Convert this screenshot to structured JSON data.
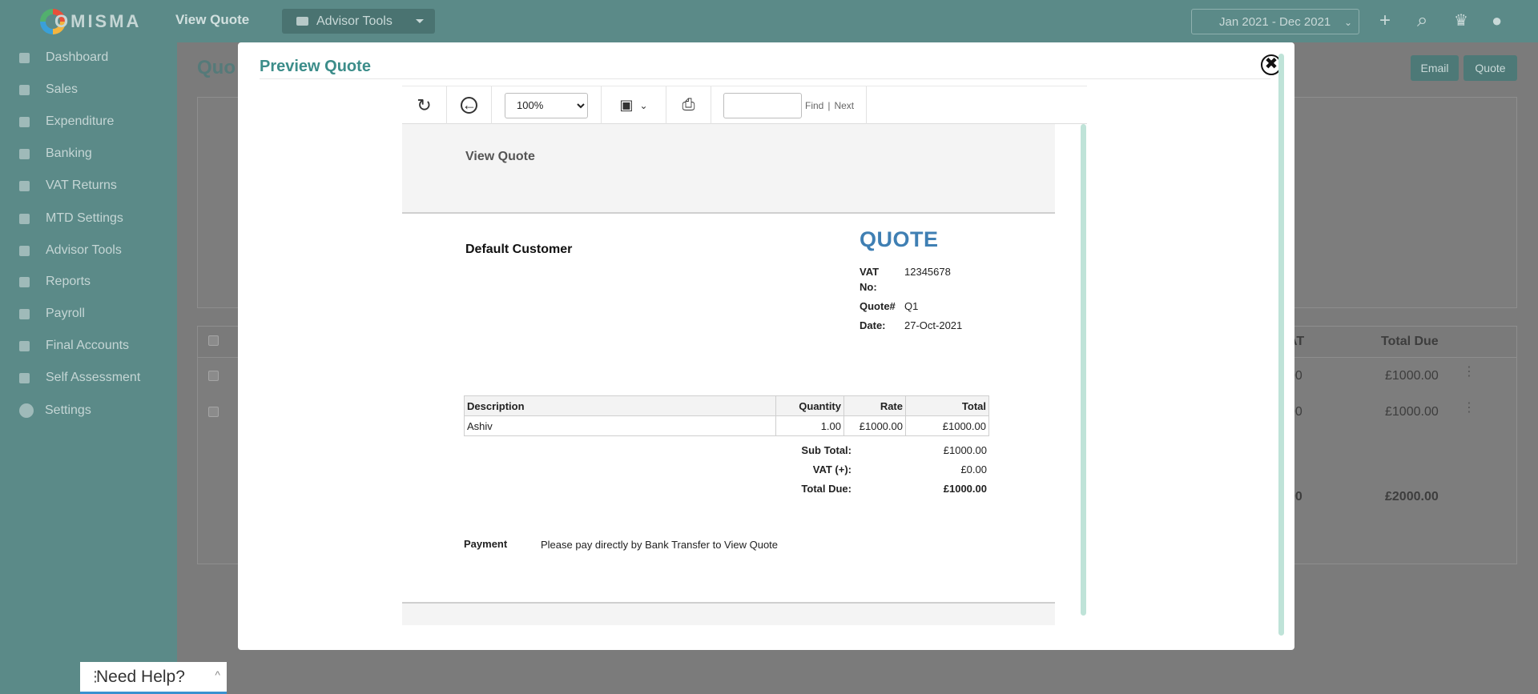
{
  "app": {
    "logo_text": "OMISMA",
    "page_title": "View Quote",
    "advisor_tools_label": "Advisor Tools",
    "period": "Jan 2021 - Dec 2021"
  },
  "sidebar": {
    "items": [
      {
        "label": "Dashboard"
      },
      {
        "label": "Sales"
      },
      {
        "label": "Expenditure"
      },
      {
        "label": "Banking"
      },
      {
        "label": "VAT Returns"
      },
      {
        "label": "MTD Settings"
      },
      {
        "label": "Advisor Tools"
      },
      {
        "label": "Reports"
      },
      {
        "label": "Payroll"
      },
      {
        "label": "Final Accounts"
      },
      {
        "label": "Self Assessment"
      },
      {
        "label": "Settings"
      }
    ]
  },
  "background": {
    "title": "Quo",
    "email_btn": "Email",
    "quote_btn": "Quote",
    "col_vat": "AT",
    "col_total_due": "Total Due",
    "rows": [
      {
        "vat": "00",
        "total_due": "£1000.00"
      },
      {
        "vat": "00",
        "total_due": "£1000.00"
      }
    ],
    "totals": {
      "vat": "00",
      "total_due": "£2000.00"
    }
  },
  "help": {
    "label": "Need Help?"
  },
  "modal": {
    "title": "Preview Quote",
    "close_symbol": "✖",
    "toolbar": {
      "zoom_value": "100%",
      "zoom_options": [
        "100%"
      ],
      "find_label": "Find",
      "separator": "|",
      "next_label": "Next"
    },
    "document": {
      "header_title": "View Quote",
      "customer_name": "Default Customer",
      "quote_heading": "QUOTE",
      "meta": {
        "vat_label_1": "VAT",
        "vat_label_2": "No:",
        "vat_value": "12345678",
        "quote_no_label": "Quote#",
        "quote_no_value": "Q1",
        "date_label": "Date:",
        "date_value": "27-Oct-2021"
      },
      "table": {
        "headers": {
          "description": "Description",
          "quantity": "Quantity",
          "rate": "Rate",
          "total": "Total"
        },
        "rows": [
          {
            "description": "Ashiv",
            "quantity": "1.00",
            "rate": "£1000.00",
            "total": "£1000.00"
          }
        ]
      },
      "summary": {
        "subtotal_label": "Sub Total:",
        "subtotal_value": "£1000.00",
        "vat_label": "VAT (+):",
        "vat_value": "£0.00",
        "total_label": "Total Due:",
        "total_value": "£1000.00"
      },
      "payment": {
        "label": "Payment",
        "text": "Please pay directly by Bank Transfer to View Quote"
      }
    }
  }
}
